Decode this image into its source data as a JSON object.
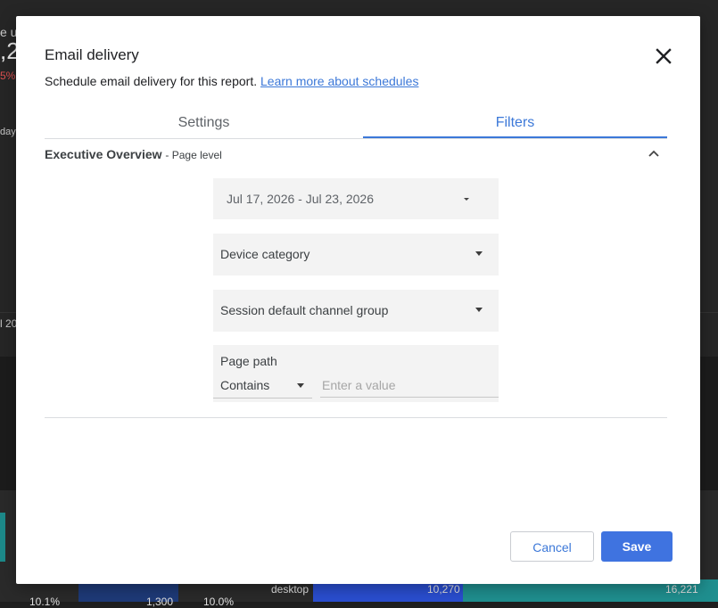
{
  "background": {
    "metric_partial": ",2",
    "label_partial": "e us",
    "change_partial": "5%",
    "axis_partial_days": "days",
    "axis_partial_date": "l 20",
    "row": {
      "pct_left": "10.1%",
      "value_mid": "1,300",
      "pct_mid": "10.0%",
      "device": "desktop",
      "value1": "10,270",
      "value2": "16,221"
    }
  },
  "dialog": {
    "title": "Email delivery",
    "subtitle": "Schedule email delivery for this report.",
    "learn_more_link": "Learn more about schedules",
    "tabs": [
      {
        "label": "Settings",
        "active": false
      },
      {
        "label": "Filters",
        "active": true
      }
    ],
    "section": {
      "page_name": "Executive Overview",
      "level_text": "- Page level"
    },
    "filters": {
      "date_range": "Jul 17, 2026 - Jul 23, 2026",
      "device_category": "Device category",
      "channel_group": "Session default channel group",
      "page_path": {
        "label": "Page path",
        "operator": "Contains",
        "value": "",
        "placeholder": "Enter a value"
      }
    },
    "buttons": {
      "cancel": "Cancel",
      "save": "Save"
    }
  },
  "colors": {
    "accent": "#3c78d8",
    "save_button": "#3f73e0",
    "field_bg": "#f3f3f3"
  },
  "icons": {
    "close": "close-icon",
    "collapse": "chevron-up-icon",
    "dropdown": "dropdown-arrow-icon"
  }
}
